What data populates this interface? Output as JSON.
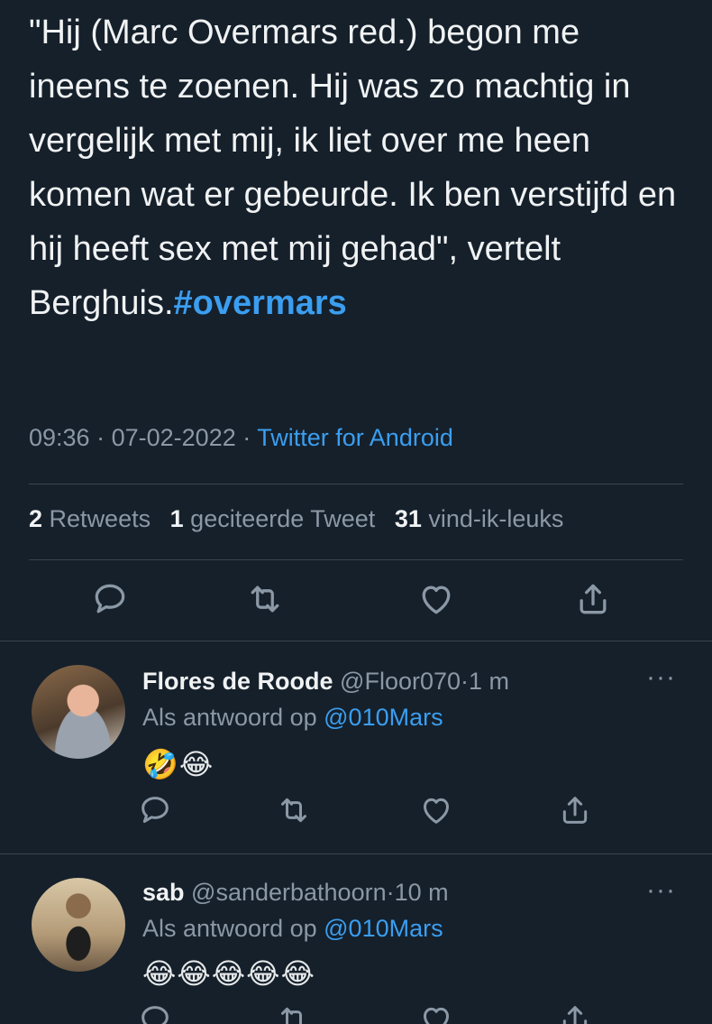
{
  "tweet": {
    "text": "\"Hij (Marc Overmars red.) begon me ineens te zoenen. Hij was zo machtig in vergelijk met mij, ik liet over me heen komen wat er gebeurde. Ik ben verstijfd en hij heeft sex met mij gehad\", vertelt Berghuis.",
    "hashtag": "#overmars",
    "time": "09:36",
    "date": "07-02-2022",
    "source": "Twitter for Android",
    "separator": "·"
  },
  "stats": {
    "retweets_count": "2",
    "retweets_label": "Retweets",
    "quotes_count": "1",
    "quotes_label": "geciteerde Tweet",
    "likes_count": "31",
    "likes_label": "vind-ik-leuks"
  },
  "actions": {
    "icons": [
      "reply-icon",
      "retweet-icon",
      "like-icon",
      "share-icon"
    ]
  },
  "replies": [
    {
      "name": "Flores de Roode",
      "handle": "@Floor070",
      "time": "1 m",
      "reply_prefix": "Als antwoord op",
      "reply_mention": "@010Mars",
      "emojis": "🤣😂"
    },
    {
      "name": "sab",
      "handle": "@sanderbathoorn",
      "time": "10 m",
      "reply_prefix": "Als antwoord op",
      "reply_mention": "@010Mars",
      "emojis": "😂😂😂😂😂"
    }
  ],
  "more_label": "···",
  "colors": {
    "background": "#15202b",
    "text": "#f0f2f3",
    "muted": "#8b98a5",
    "accent": "#3b9ef0",
    "divider": "#38444d"
  }
}
